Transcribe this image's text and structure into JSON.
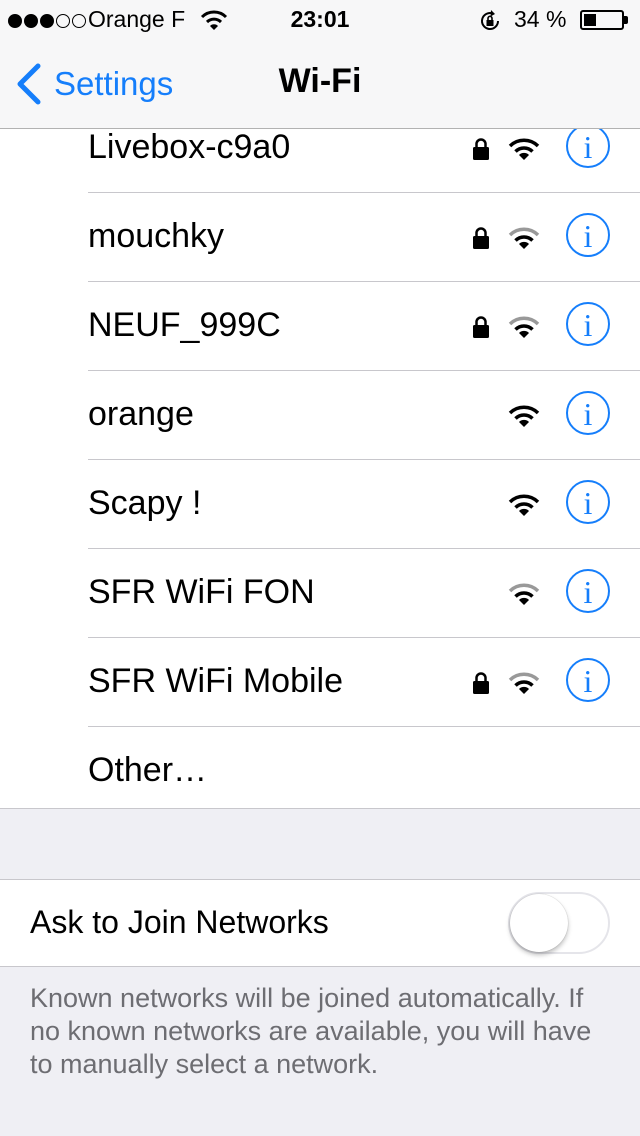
{
  "status_bar": {
    "signal_filled": 3,
    "signal_total": 5,
    "carrier": "Orange F",
    "time": "23:01",
    "battery_percent_text": "34 %",
    "battery_level": 0.34
  },
  "nav": {
    "back_label": "Settings",
    "title": "Wi-Fi"
  },
  "networks": [
    {
      "name": "Livebox-c9a0",
      "secured": true,
      "signal": "strong"
    },
    {
      "name": "mouchky",
      "secured": true,
      "signal": "medium"
    },
    {
      "name": "NEUF_999C",
      "secured": true,
      "signal": "medium"
    },
    {
      "name": "orange",
      "secured": false,
      "signal": "strong"
    },
    {
      "name": "Scapy !",
      "secured": false,
      "signal": "strong"
    },
    {
      "name": "SFR WiFi FON",
      "secured": false,
      "signal": "medium"
    },
    {
      "name": "SFR WiFi Mobile",
      "secured": true,
      "signal": "medium"
    }
  ],
  "other_label": "Other…",
  "ask_to_join": {
    "label": "Ask to Join Networks",
    "enabled": false
  },
  "footer_note": "Known networks will be joined automatically. If no known networks are available, you will have to manually select a network.",
  "icons": {
    "back": "chevron-left-icon",
    "lock": "lock-icon",
    "wifi": "wifi-icon",
    "info": "info-icon",
    "rotation_lock": "rotation-lock-icon",
    "battery": "battery-icon"
  },
  "colors": {
    "accent": "#157efb",
    "background": "#efeff4",
    "separator": "#c8c7cc",
    "footer_text": "#6d6d72"
  }
}
